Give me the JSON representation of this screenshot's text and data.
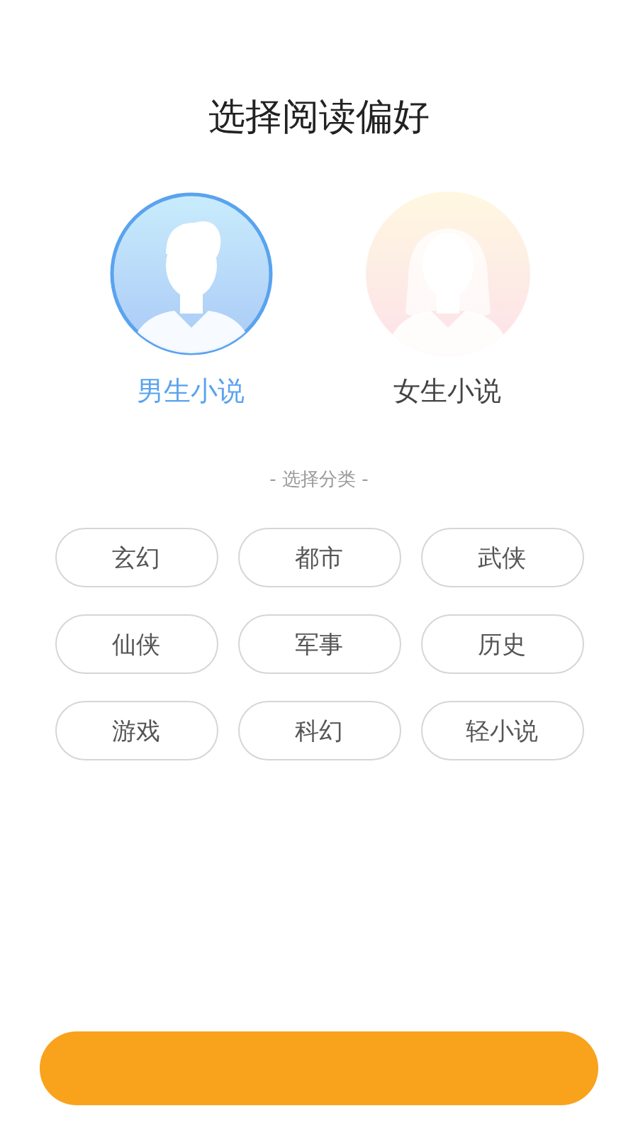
{
  "title": "选择阅读偏好",
  "genders": [
    {
      "kind": "male",
      "label": "男生小说",
      "selected": true
    },
    {
      "kind": "female",
      "label": "女生小说",
      "selected": false
    }
  ],
  "category_heading": "- 选择分类 -",
  "categories": [
    {
      "label": "玄幻"
    },
    {
      "label": "都市"
    },
    {
      "label": "武侠"
    },
    {
      "label": "仙侠"
    },
    {
      "label": "军事"
    },
    {
      "label": "历史"
    },
    {
      "label": "游戏"
    },
    {
      "label": "科幻"
    },
    {
      "label": "轻小说"
    }
  ],
  "confirm_button": {
    "kind": "button"
  }
}
